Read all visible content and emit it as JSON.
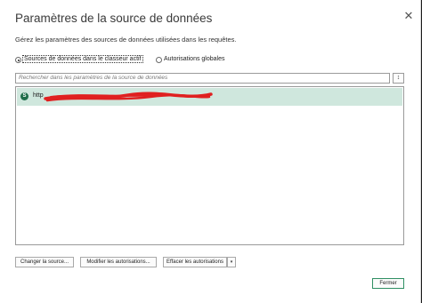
{
  "dialog": {
    "title": "Paramètres de la source de données",
    "close_glyph": "✕",
    "description": "Gérez les paramètres des sources de données utilisées dans les requêtes."
  },
  "scope": {
    "options": [
      {
        "label": "Sources de données dans le classeur actif",
        "selected": true
      },
      {
        "label": "Autorisations globales",
        "selected": false
      }
    ]
  },
  "search": {
    "placeholder": "Rechercher dans les paramètres de la source de données",
    "sort_glyph": "↕"
  },
  "sources": [
    {
      "icon": "sharepoint-icon",
      "icon_letter": "S",
      "label": "http",
      "selected": true,
      "redacted": true
    }
  ],
  "buttons": {
    "change_source": "Changer la source...",
    "edit_permissions": "Modifier les autorisations...",
    "clear_permissions": "Effacer les autorisations",
    "clear_dropdown_glyph": "▾",
    "close": "Fermer"
  },
  "colors": {
    "selection": "#cfe7dd",
    "icon": "#1f6e4a",
    "redaction": "#e02020",
    "primary_border": "#2f8f63"
  }
}
